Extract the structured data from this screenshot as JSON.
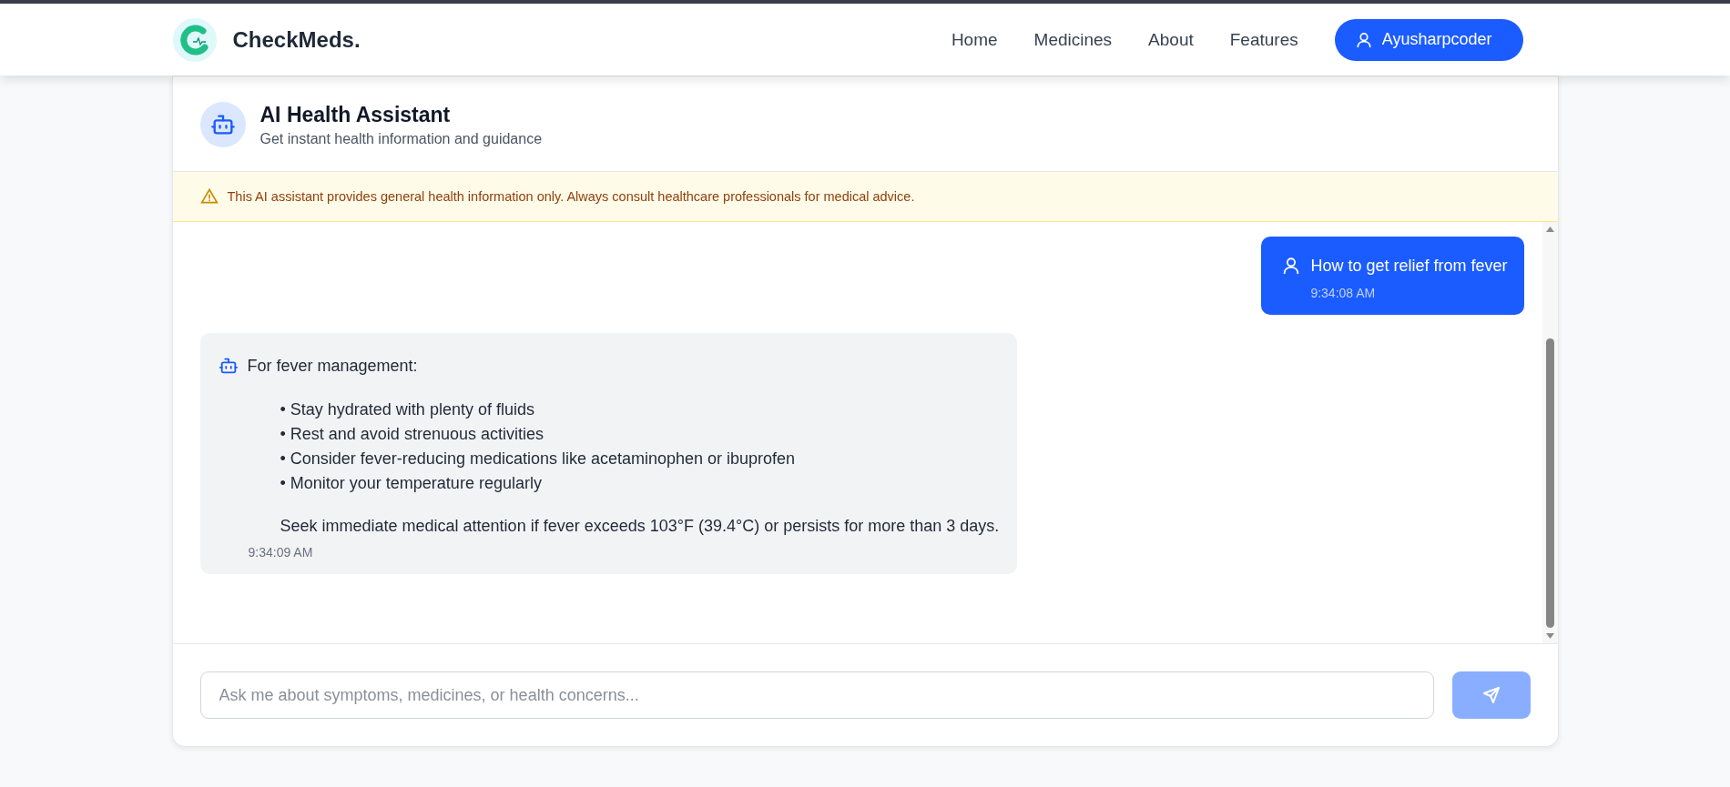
{
  "navbar": {
    "brand": "CheckMeds.",
    "links": [
      "Home",
      "Medicines",
      "About",
      "Features"
    ],
    "user_button": "Ayusharpcoder"
  },
  "assistant": {
    "title": "AI Health Assistant",
    "subtitle": "Get instant health information and guidance"
  },
  "disclaimer": "This AI assistant provides general health information only. Always consult healthcare professionals for medical advice.",
  "messages": [
    {
      "kind": "user",
      "text": "How to get relief from fever",
      "time": "9:34:08 AM"
    },
    {
      "kind": "bot",
      "text": "For fever management:",
      "bullets": [
        "• Stay hydrated with plenty of fluids",
        "• Rest and avoid strenuous activities",
        "• Consider fever-reducing medications like acetaminophen or ibuprofen",
        "• Monitor your temperature regularly"
      ],
      "note": "Seek immediate medical attention if fever exceeds 103°F (39.4°C) or persists for more than 3 days.",
      "time": "9:34:09 AM"
    }
  ],
  "composer": {
    "placeholder": "Ask me about symptoms, medicines, or health concerns...",
    "send_disabled": true
  }
}
